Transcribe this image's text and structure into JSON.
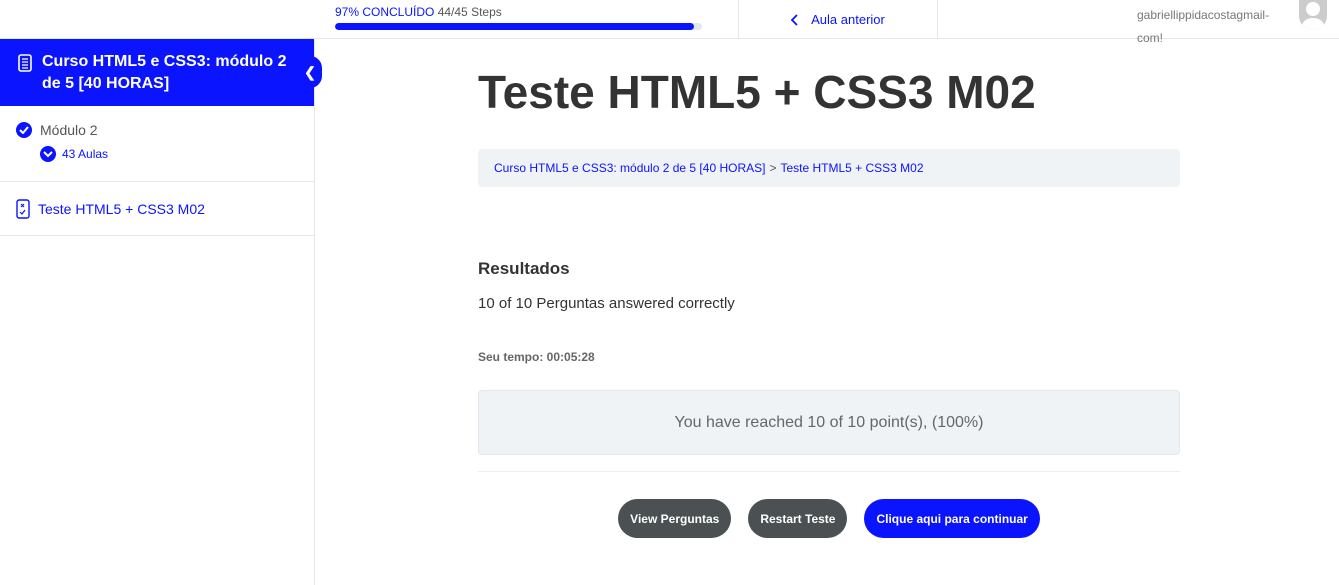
{
  "topbar": {
    "progress_percent_label": "97% CONCLUÍDO",
    "progress_steps": "44/45 Steps",
    "progress_value": 97.8,
    "prev_label": "Aula anterior",
    "user_line1": "gabriellippidacostagmail-",
    "user_line2": "com!"
  },
  "sidebar": {
    "course_title": "Curso HTML5 e CSS3: módulo 2 de 5 [40 HORAS]",
    "module": "Módulo 2",
    "lessons_count": "43 Aulas",
    "lesson": "Teste HTML5 + CSS3 M02"
  },
  "main": {
    "title": "Teste HTML5 + CSS3 M02",
    "crumb1": "Curso HTML5 e CSS3: módulo 2 de 5 [40 HORAS]",
    "crumb_sep": ">",
    "crumb2": "Teste HTML5 + CSS3 M02",
    "results_heading": "Resultados",
    "answered": "10 of 10 Perguntas answered correctly",
    "time": "Seu tempo: 00:05:28",
    "points": "You have reached 10 of 10 point(s), (100%)",
    "btn_view": "View Perguntas",
    "btn_restart": "Restart Teste",
    "btn_continue": "Clique aqui para continuar"
  },
  "colors": {
    "accent": "#0a14ff",
    "button_gray": "#4b5152"
  }
}
